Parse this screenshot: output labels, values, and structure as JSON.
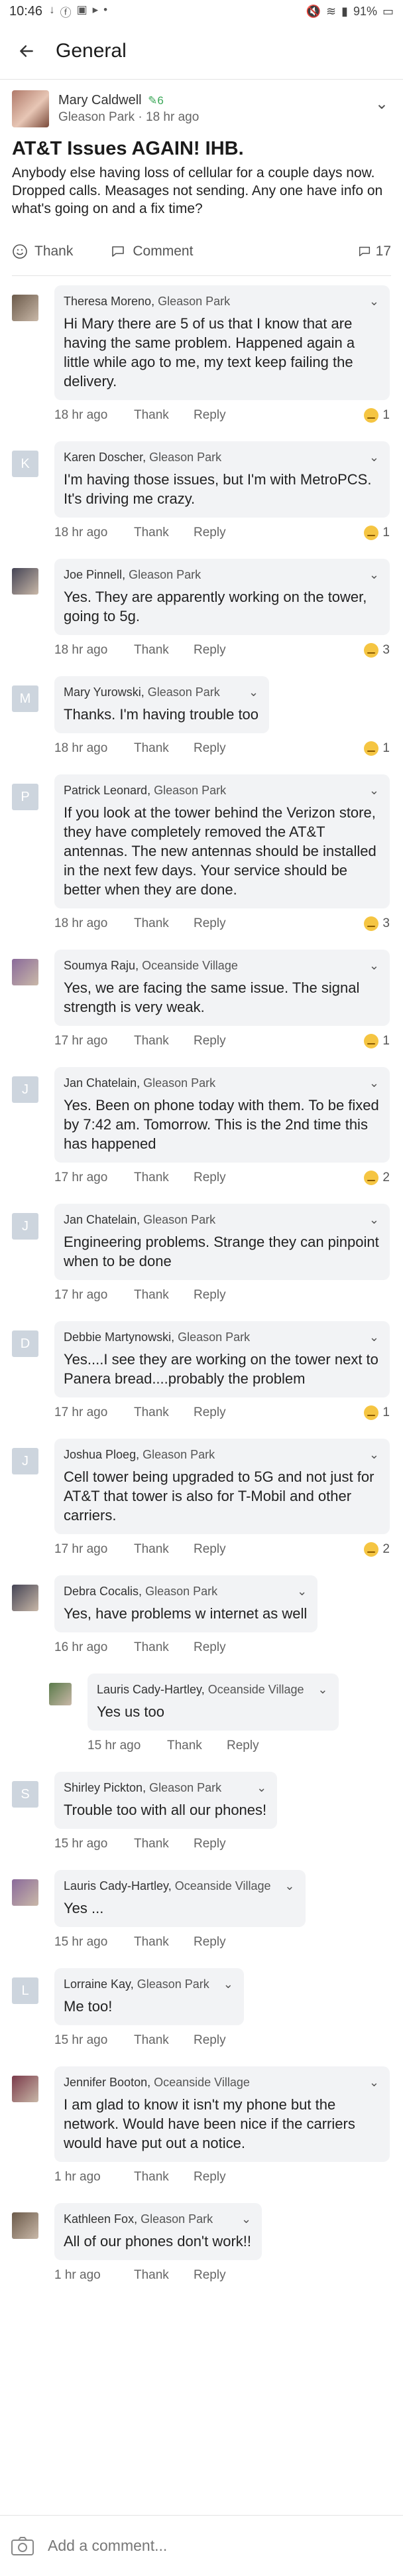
{
  "status_bar": {
    "time": "10:46",
    "battery": "91%"
  },
  "header": {
    "title": "General"
  },
  "post": {
    "author": "Mary Caldwell",
    "badge": "6",
    "location": "Gleason Park",
    "age": "18 hr ago",
    "title": "AT&T Issues AGAIN! IHB.",
    "body": "Anybody else having loss of cellular for a couple days now.\nDropped calls. Measages not sending. Any one have info on what's going on and a fix time?",
    "thank_label": "Thank",
    "comment_label": "Comment",
    "comment_count": "17"
  },
  "labels": {
    "thank": "Thank",
    "reply": "Reply",
    "add_comment_placeholder": "Add a comment..."
  },
  "comments": [
    {
      "name": "Theresa Moreno",
      "loc": "Gleason Park",
      "text": "Hi Mary there are 5 of us that I know that are having the same problem. Happened again a little while ago to me, my text keep failing the delivery.",
      "age": "18 hr ago",
      "reactions": "1",
      "avatar": "photo"
    },
    {
      "name": "Karen Doscher",
      "loc": "Gleason Park",
      "text": "I'm having those issues, but I'm with MetroPCS. It's driving me crazy.",
      "age": "18 hr ago",
      "reactions": "1",
      "avatar": "K"
    },
    {
      "name": "Joe Pinnell",
      "loc": "Gleason Park",
      "text": "Yes. They are apparently working on the tower, going to 5g.",
      "age": "18 hr ago",
      "reactions": "3",
      "avatar": "photo"
    },
    {
      "name": "Mary Yurowski",
      "loc": "Gleason Park",
      "text": "Thanks. I'm having trouble too",
      "age": "18 hr ago",
      "reactions": "1",
      "avatar": "M"
    },
    {
      "name": "Patrick Leonard",
      "loc": "Gleason Park",
      "text": "If you look at the tower behind the Verizon store, they have completely removed the AT&T antennas. The new antennas should be installed in the next few days. Your service should be better when they are done.",
      "age": "18 hr ago",
      "reactions": "3",
      "avatar": "P"
    },
    {
      "name": "Soumya Raju",
      "loc": "Oceanside Village",
      "text": "Yes, we are facing the same issue. The signal strength is very weak.",
      "age": "17 hr ago",
      "reactions": "1",
      "avatar": "photo"
    },
    {
      "name": "Jan Chatelain",
      "loc": "Gleason Park",
      "text": "Yes. Been on phone today with them. To be fixed by 7:42 am. Tomorrow. This is the 2nd time this has happened",
      "age": "17 hr ago",
      "reactions": "2",
      "avatar": "J"
    },
    {
      "name": "Jan Chatelain",
      "loc": "Gleason Park",
      "text": "Engineering problems. Strange they can pinpoint when to be done",
      "age": "17 hr ago",
      "reactions": "",
      "avatar": "J"
    },
    {
      "name": "Debbie Martynowski",
      "loc": "Gleason Park",
      "text": "Yes....I see they are working on the tower next to Panera bread....probably the problem",
      "age": "17 hr ago",
      "reactions": "1",
      "avatar": "D"
    },
    {
      "name": "Joshua Ploeg",
      "loc": "Gleason Park",
      "text": "Cell tower being upgraded to 5G and not just for AT&T that tower is also for T-Mobil and other carriers.",
      "age": "17 hr ago",
      "reactions": "2",
      "avatar": "J"
    },
    {
      "name": "Debra Cocalis",
      "loc": "Gleason Park",
      "text": "Yes, have problems w internet as well",
      "age": "16 hr ago",
      "reactions": "",
      "avatar": "photo"
    },
    {
      "name": "Lauris Cady-Hartley",
      "loc": "Oceanside Village",
      "text": "Yes us too",
      "age": "15 hr ago",
      "reactions": "",
      "avatar": "photo",
      "reply": true
    },
    {
      "name": "Shirley Pickton",
      "loc": "Gleason Park",
      "text": "Trouble too with all our phones!",
      "age": "15 hr ago",
      "reactions": "",
      "avatar": "S"
    },
    {
      "name": "Lauris Cady-Hartley",
      "loc": "Oceanside Village",
      "text": "Yes ...",
      "age": "15 hr ago",
      "reactions": "",
      "avatar": "photo"
    },
    {
      "name": "Lorraine Kay",
      "loc": "Gleason Park",
      "text": "Me too!",
      "age": "15 hr ago",
      "reactions": "",
      "avatar": "L"
    },
    {
      "name": "Jennifer Booton",
      "loc": "Oceanside Village",
      "text": "I am glad to know it isn't my phone but the network. Would have been nice if the carriers would have put out a notice.",
      "age": "1 hr ago",
      "reactions": "",
      "avatar": "photo"
    },
    {
      "name": "Kathleen Fox",
      "loc": "Gleason Park",
      "text": "All of our phones don't work!!",
      "age": "1 hr ago",
      "reactions": "",
      "avatar": "photo"
    }
  ],
  "colors": {
    "accent_green": "#3aa757",
    "bubble_bg": "#f2f3f5",
    "emoji_yellow": "#f5c542"
  }
}
